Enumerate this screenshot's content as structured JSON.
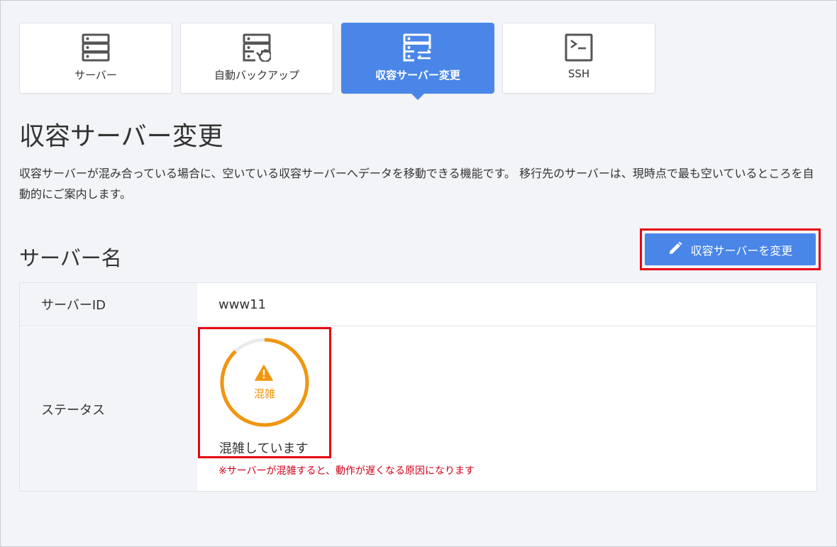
{
  "tabs": [
    {
      "label": "サーバー",
      "icon": "server-icon",
      "active": false
    },
    {
      "label": "自動バックアップ",
      "icon": "server-backup-icon",
      "active": false
    },
    {
      "label": "収容サーバー変更",
      "icon": "server-transfer-icon",
      "active": true
    },
    {
      "label": "SSH",
      "icon": "terminal-icon",
      "active": false
    }
  ],
  "page": {
    "title": "収容サーバー変更",
    "description": "収容サーバーが混み合っている場合に、空いている収容サーバーへデータを移動できる機能です。 移行先のサーバーは、現時点で最も空いているところを自動的にご案内します。"
  },
  "section": {
    "title": "サーバー名",
    "change_button_label": "収容サーバーを変更",
    "change_button_icon": "pencil-icon"
  },
  "table": {
    "server_id_label": "サーバーID",
    "server_id_value": "www11",
    "status_label": "ステータス",
    "status_badge": "混雑",
    "status_text": "混雑しています",
    "status_note": "※サーバーが混雑すると、動作が遅くなる原因になります",
    "status_level": 0.88,
    "status_icon": "warning-icon"
  },
  "colors": {
    "accent": "#4a86e8",
    "highlight": "#e60012",
    "warning": "#f0960f",
    "note": "#d0021b"
  }
}
